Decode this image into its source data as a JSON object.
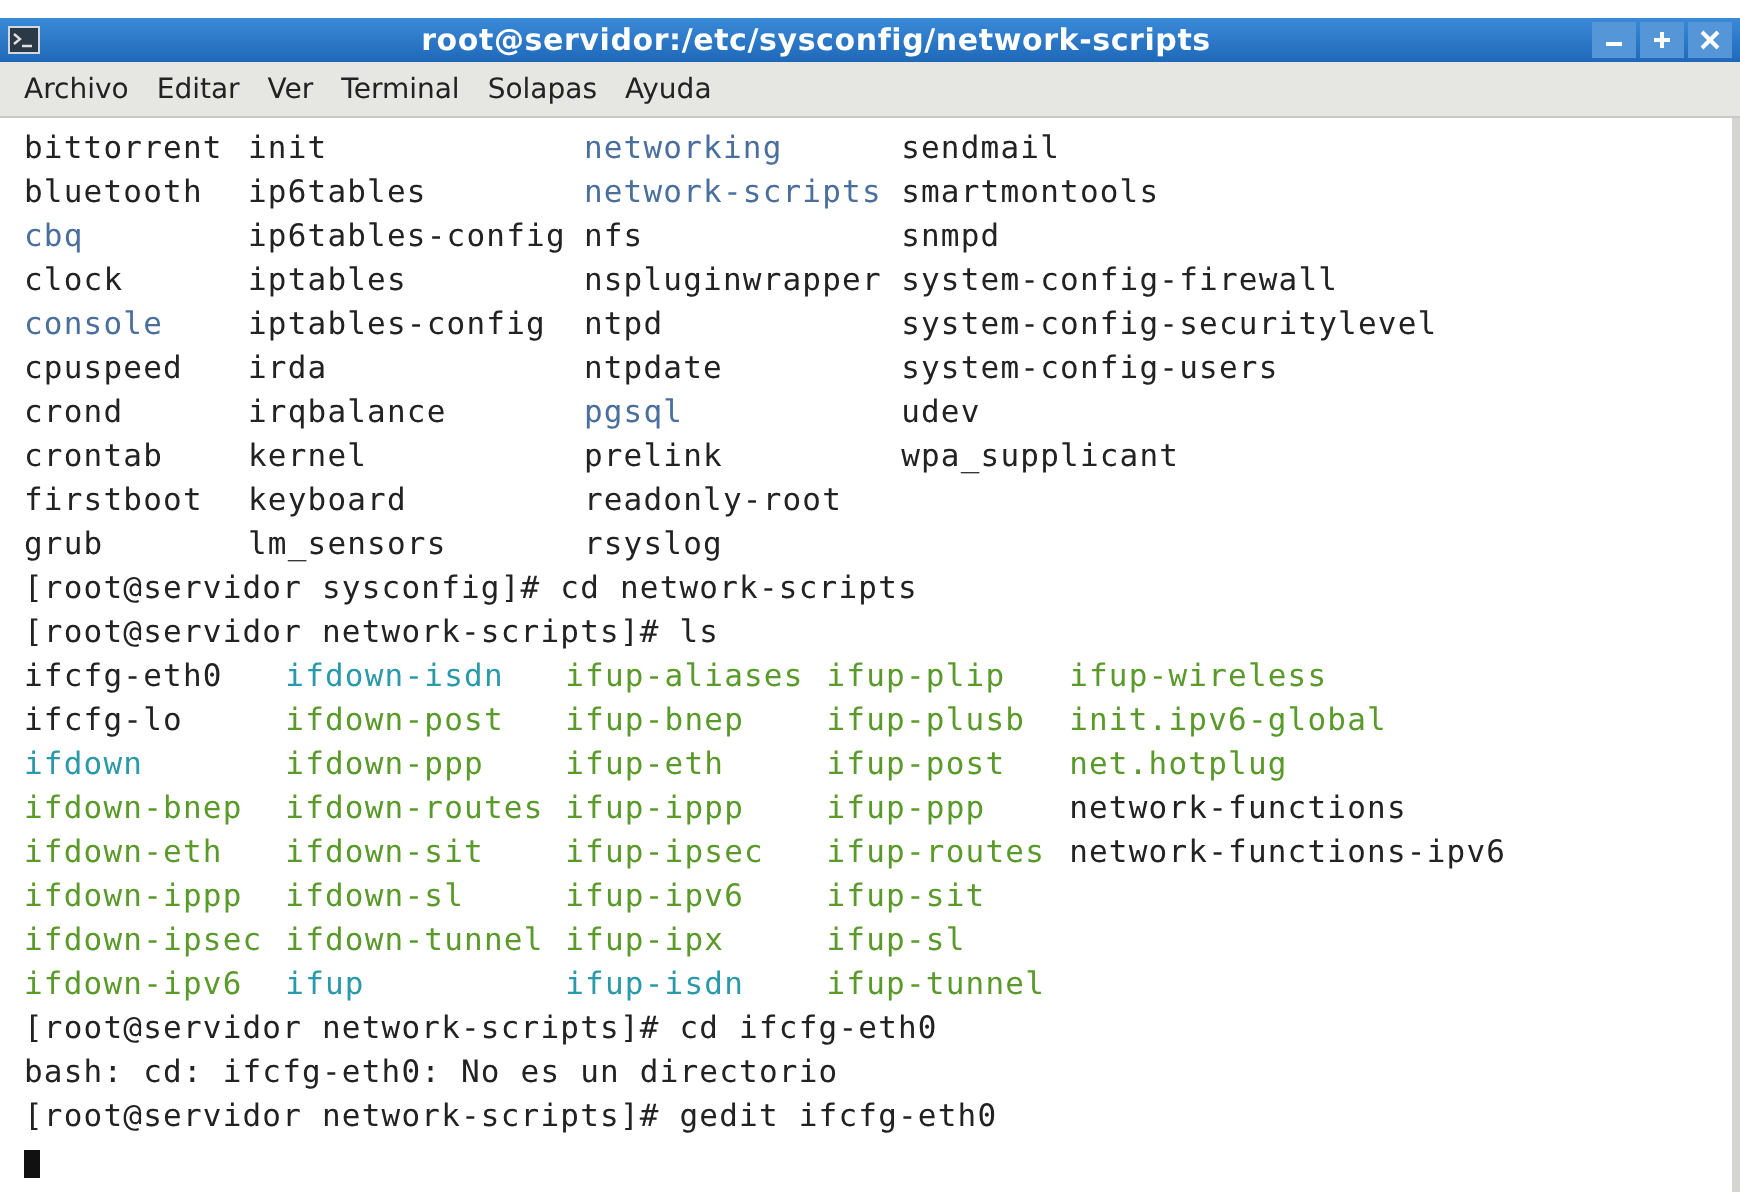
{
  "window": {
    "title": "root@servidor:/etc/sysconfig/network-scripts",
    "controls": [
      {
        "kind": "minimize"
      },
      {
        "kind": "maximize"
      },
      {
        "kind": "close"
      }
    ]
  },
  "menu": [
    {
      "label": "Archivo"
    },
    {
      "label": "Editar"
    },
    {
      "label": "Ver"
    },
    {
      "label": "Terminal"
    },
    {
      "label": "Solapas"
    },
    {
      "label": "Ayuda"
    }
  ],
  "terminal": {
    "lines": [
      {
        "kind": "listing",
        "rows": [
          [
            {
              "text": "bittorrent",
              "color": "#222222"
            },
            {
              "text": "init",
              "color": "#222222"
            },
            {
              "text": "networking",
              "color": "#4a6f9c"
            },
            {
              "text": "sendmail",
              "color": "#222222"
            }
          ],
          [
            {
              "text": "bluetooth",
              "color": "#222222"
            },
            {
              "text": "ip6tables",
              "color": "#222222"
            },
            {
              "text": "network-scripts",
              "color": "#4a6f9c"
            },
            {
              "text": "smartmontools",
              "color": "#222222"
            }
          ],
          [
            {
              "text": "cbq",
              "color": "#4a6f9c"
            },
            {
              "text": "ip6tables-config",
              "color": "#222222"
            },
            {
              "text": "nfs",
              "color": "#222222"
            },
            {
              "text": "snmpd",
              "color": "#222222"
            }
          ],
          [
            {
              "text": "clock",
              "color": "#222222"
            },
            {
              "text": "iptables",
              "color": "#222222"
            },
            {
              "text": "nspluginwrapper",
              "color": "#222222"
            },
            {
              "text": "system-config-firewall",
              "color": "#222222"
            }
          ],
          [
            {
              "text": "console",
              "color": "#4a6f9c"
            },
            {
              "text": "iptables-config",
              "color": "#222222"
            },
            {
              "text": "ntpd",
              "color": "#222222"
            },
            {
              "text": "system-config-securitylevel",
              "color": "#222222"
            }
          ],
          [
            {
              "text": "cpuspeed",
              "color": "#222222"
            },
            {
              "text": "irda",
              "color": "#222222"
            },
            {
              "text": "ntpdate",
              "color": "#222222"
            },
            {
              "text": "system-config-users",
              "color": "#222222"
            }
          ],
          [
            {
              "text": "crond",
              "color": "#222222"
            },
            {
              "text": "irqbalance",
              "color": "#222222"
            },
            {
              "text": "pgsql",
              "color": "#4a6f9c"
            },
            {
              "text": "udev",
              "color": "#222222"
            }
          ],
          [
            {
              "text": "crontab",
              "color": "#222222"
            },
            {
              "text": "kernel",
              "color": "#222222"
            },
            {
              "text": "prelink",
              "color": "#222222"
            },
            {
              "text": "wpa_supplicant",
              "color": "#222222"
            }
          ],
          [
            {
              "text": "firstboot",
              "color": "#222222"
            },
            {
              "text": "keyboard",
              "color": "#222222"
            },
            {
              "text": "readonly-root",
              "color": "#222222"
            }
          ],
          [
            {
              "text": "grub",
              "color": "#222222"
            },
            {
              "text": "lm_sensors",
              "color": "#222222"
            },
            {
              "text": "rsyslog",
              "color": "#222222"
            }
          ]
        ]
      },
      {
        "kind": "text",
        "text": "[root@servidor sysconfig]# cd network-scripts"
      },
      {
        "kind": "text",
        "text": "[root@servidor network-scripts]# ls"
      },
      {
        "kind": "listing",
        "rows": [
          [
            {
              "text": "ifcfg-eth0",
              "color": "#222222"
            },
            {
              "text": "ifdown-isdn",
              "color": "#2a9aaa"
            },
            {
              "text": "ifup-aliases",
              "color": "#5a9a2a"
            },
            {
              "text": "ifup-plip",
              "color": "#5a9a2a"
            },
            {
              "text": "ifup-wireless",
              "color": "#5a9a2a"
            }
          ],
          [
            {
              "text": "ifcfg-lo",
              "color": "#222222"
            },
            {
              "text": "ifdown-post",
              "color": "#5a9a2a"
            },
            {
              "text": "ifup-bnep",
              "color": "#5a9a2a"
            },
            {
              "text": "ifup-plusb",
              "color": "#5a9a2a"
            },
            {
              "text": "init.ipv6-global",
              "color": "#5a9a2a"
            }
          ],
          [
            {
              "text": "ifdown",
              "color": "#2a9aaa"
            },
            {
              "text": "ifdown-ppp",
              "color": "#5a9a2a"
            },
            {
              "text": "ifup-eth",
              "color": "#5a9a2a"
            },
            {
              "text": "ifup-post",
              "color": "#5a9a2a"
            },
            {
              "text": "net.hotplug",
              "color": "#5a9a2a"
            }
          ],
          [
            {
              "text": "ifdown-bnep",
              "color": "#5a9a2a"
            },
            {
              "text": "ifdown-routes",
              "color": "#5a9a2a"
            },
            {
              "text": "ifup-ippp",
              "color": "#5a9a2a"
            },
            {
              "text": "ifup-ppp",
              "color": "#5a9a2a"
            },
            {
              "text": "network-functions",
              "color": "#222222"
            }
          ],
          [
            {
              "text": "ifdown-eth",
              "color": "#5a9a2a"
            },
            {
              "text": "ifdown-sit",
              "color": "#5a9a2a"
            },
            {
              "text": "ifup-ipsec",
              "color": "#5a9a2a"
            },
            {
              "text": "ifup-routes",
              "color": "#5a9a2a"
            },
            {
              "text": "network-functions-ipv6",
              "color": "#222222"
            }
          ],
          [
            {
              "text": "ifdown-ippp",
              "color": "#5a9a2a"
            },
            {
              "text": "ifdown-sl",
              "color": "#5a9a2a"
            },
            {
              "text": "ifup-ipv6",
              "color": "#5a9a2a"
            },
            {
              "text": "ifup-sit",
              "color": "#5a9a2a"
            }
          ],
          [
            {
              "text": "ifdown-ipsec",
              "color": "#5a9a2a"
            },
            {
              "text": "ifdown-tunnel",
              "color": "#5a9a2a"
            },
            {
              "text": "ifup-ipx",
              "color": "#5a9a2a"
            },
            {
              "text": "ifup-sl",
              "color": "#5a9a2a"
            }
          ],
          [
            {
              "text": "ifdown-ipv6",
              "color": "#5a9a2a"
            },
            {
              "text": "ifup",
              "color": "#2a9aaa"
            },
            {
              "text": "ifup-isdn",
              "color": "#2a9aaa"
            },
            {
              "text": "ifup-tunnel",
              "color": "#5a9a2a"
            }
          ]
        ]
      },
      {
        "kind": "text",
        "text": "[root@servidor network-scripts]# cd ifcfg-eth0"
      },
      {
        "kind": "text",
        "text": "bash: cd: ifcfg-eth0: No es un directorio"
      },
      {
        "kind": "text",
        "text": "[root@servidor network-scripts]# gedit ifcfg-eth0"
      },
      {
        "kind": "cursor"
      }
    ]
  }
}
